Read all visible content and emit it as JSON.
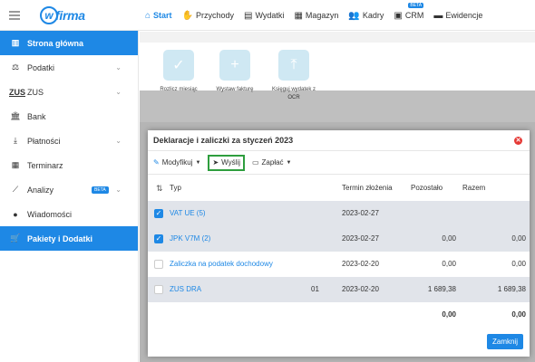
{
  "app": {
    "logo_mark": "w",
    "logo_text": "firma"
  },
  "nav": {
    "items": [
      {
        "label": "Start",
        "icon": "home-icon"
      },
      {
        "label": "Przychody",
        "icon": "hand-money-icon"
      },
      {
        "label": "Wydatki",
        "icon": "wallet-icon"
      },
      {
        "label": "Magazyn",
        "icon": "warehouse-icon"
      },
      {
        "label": "Kadry",
        "icon": "users-icon"
      },
      {
        "label": "CRM",
        "icon": "contact-card-icon",
        "badge": "BETA"
      },
      {
        "label": "Ewidencje",
        "icon": "folder-icon"
      }
    ]
  },
  "sidebar": {
    "items": [
      {
        "label": "Strona główna"
      },
      {
        "label": "Podatki"
      },
      {
        "label": "ZUS",
        "icon_text": "ZUS"
      },
      {
        "label": "Bank"
      },
      {
        "label": "Płatności"
      },
      {
        "label": "Terminarz"
      },
      {
        "label": "Analizy",
        "badge": "BETA"
      },
      {
        "label": "Wiadomości"
      },
      {
        "label": "Pakiety i Dodatki"
      }
    ]
  },
  "tiles": [
    {
      "label": "Rozlicz miesiąc"
    },
    {
      "label": "Wystaw fakturę"
    },
    {
      "label": "Księguj wydatek z OCR"
    }
  ],
  "modal": {
    "title": "Deklaracje i zaliczki za styczeń 2023",
    "toolbar": {
      "modify_label": "Modyfikuj",
      "send_label": "Wyślij",
      "pay_label": "Zapłać"
    },
    "columns": {
      "type": "Typ",
      "due": "Termin złożenia",
      "remaining": "Pozostało",
      "total": "Razem"
    },
    "rows": [
      {
        "type": "VAT UE (5)",
        "mid": "",
        "date": "2023-02-27",
        "remaining": "",
        "total": "",
        "checked": true
      },
      {
        "type": "JPK V7M (2)",
        "mid": "",
        "date": "2023-02-27",
        "remaining": "0,00",
        "total": "0,00",
        "checked": true
      },
      {
        "type": "Zaliczka na podatek dochodowy",
        "mid": "",
        "date": "2023-02-20",
        "remaining": "0,00",
        "total": "0,00",
        "checked": false
      },
      {
        "type": "ZUS DRA",
        "mid": "01",
        "date": "2023-02-20",
        "remaining": "1 689,38",
        "total": "1 689,38",
        "checked": false
      }
    ],
    "totals": {
      "remaining": "0,00",
      "total": "0,00"
    },
    "close_label": "Zamknij"
  },
  "colors": {
    "accent": "#1e88e5",
    "highlight_border": "#2e9e3e",
    "close_red": "#e53935"
  }
}
